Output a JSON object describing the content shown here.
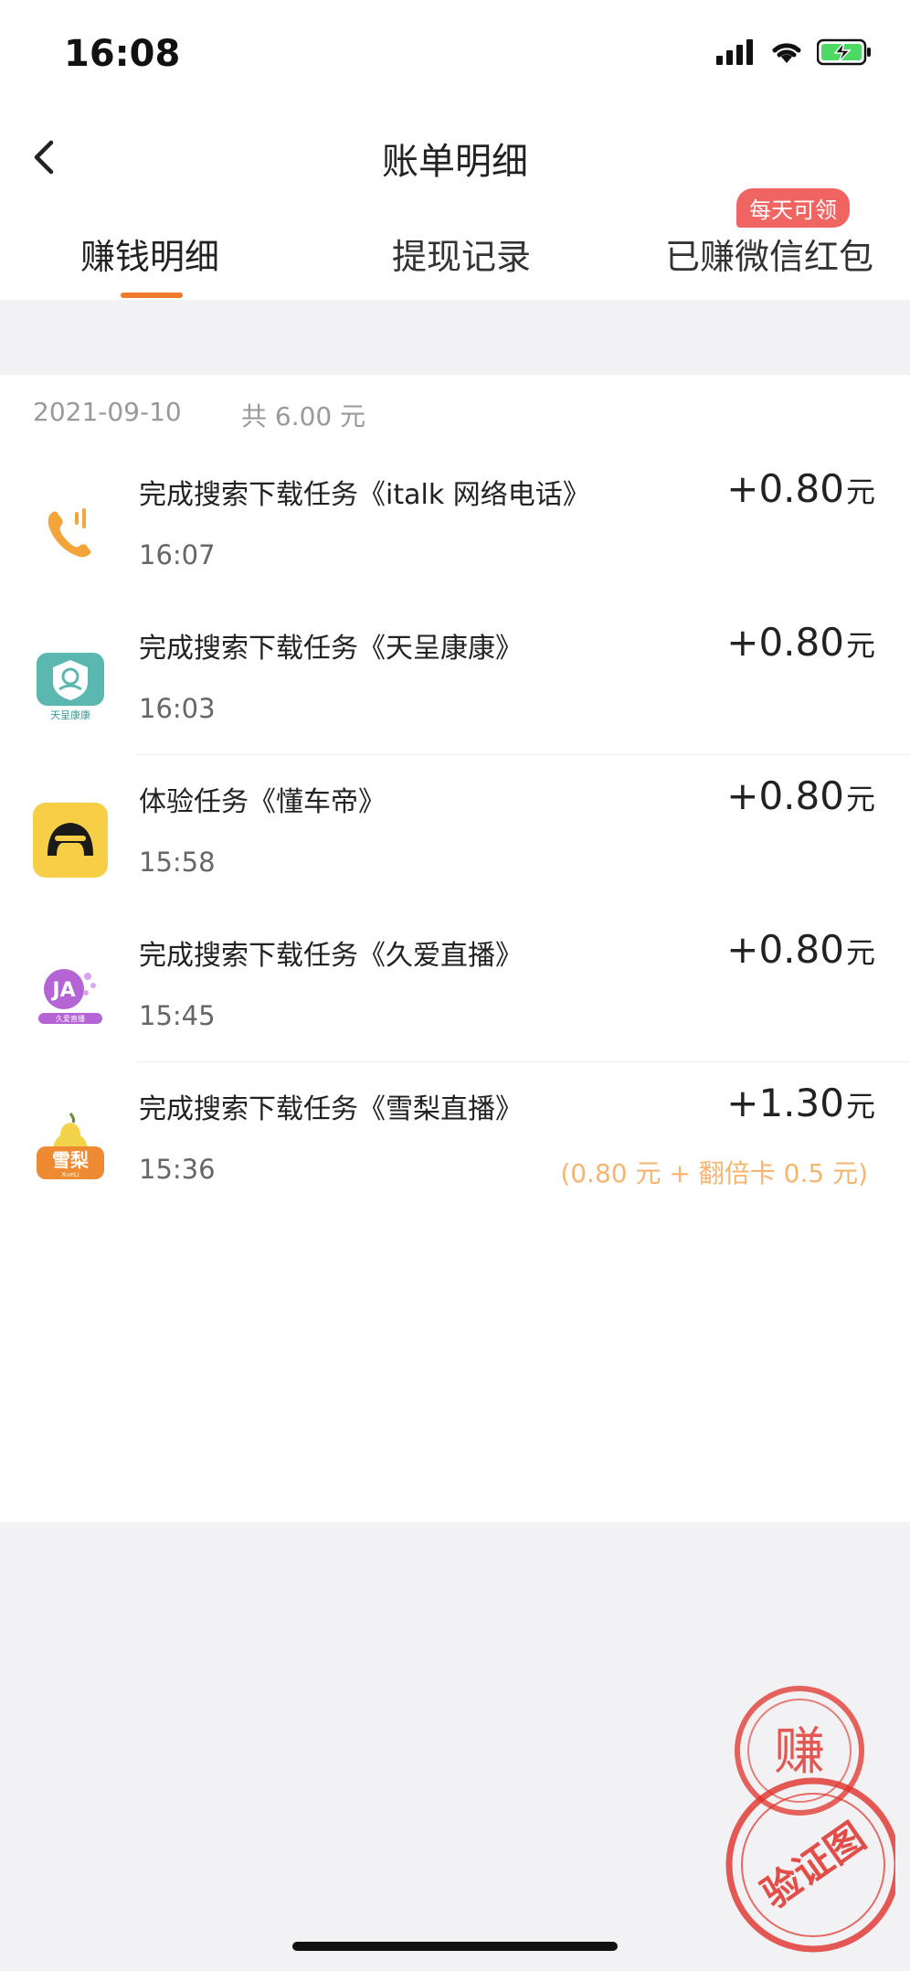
{
  "status_bar": {
    "time": "16:08"
  },
  "nav": {
    "title": "账单明细"
  },
  "tabs": [
    {
      "label": "赚钱明细",
      "active": true
    },
    {
      "label": "提现记录",
      "active": false
    },
    {
      "label": "已赚微信红包",
      "active": false,
      "badge": "每天可领"
    }
  ],
  "group": {
    "date": "2021-09-10",
    "total": "共 6.00 元"
  },
  "items": [
    {
      "title": "完成搜索下载任务《italk 网络电话》",
      "time": "16:07",
      "amount": "+0.80",
      "unit": "元",
      "icon": "phone-app-icon"
    },
    {
      "title": "完成搜索下载任务《天呈康康》",
      "time": "16:03",
      "amount": "+0.80",
      "unit": "元",
      "icon": "health-app-icon",
      "icon_text": "天呈康康"
    },
    {
      "title": "体验任务《懂车帝》",
      "time": "15:58",
      "amount": "+0.80",
      "unit": "元",
      "icon": "car-app-icon"
    },
    {
      "title": "完成搜索下载任务《久爱直播》",
      "time": "15:45",
      "amount": "+0.80",
      "unit": "元",
      "icon": "live-app-icon",
      "icon_text": "JA",
      "icon_sub": "久爱直播"
    },
    {
      "title": "完成搜索下载任务《雪梨直播》",
      "time": "15:36",
      "amount": "+1.30",
      "unit": "元",
      "note": "(0.80 元 + 翻倍卡 0.5 元)",
      "icon": "pear-app-icon",
      "icon_text": "雪梨",
      "icon_sub": "XueLi"
    }
  ],
  "stamps": {
    "top": "赚",
    "bottom": "验证图"
  },
  "colors": {
    "accent": "#f07a2c",
    "badge": "#f06462",
    "note": "#f6b56e",
    "stamp": "#e0312a"
  }
}
